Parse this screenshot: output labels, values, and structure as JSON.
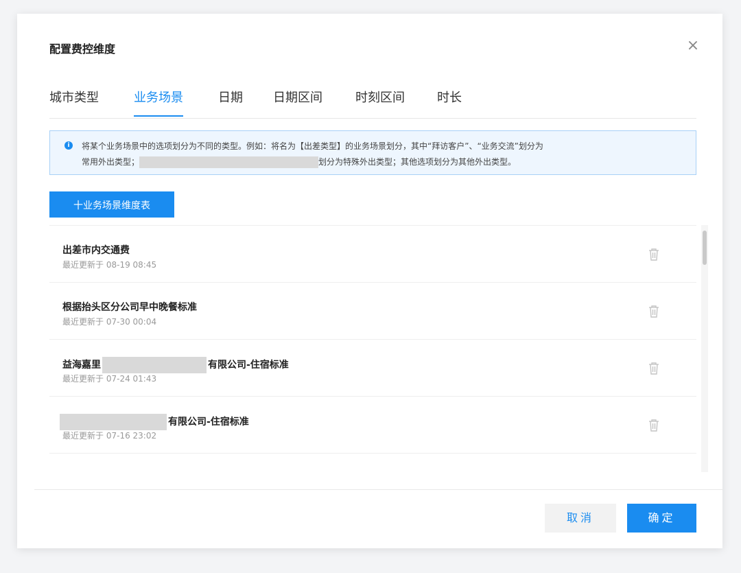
{
  "dialog": {
    "title": "配置费控维度",
    "close_glyph": "×"
  },
  "tabs": [
    {
      "label": "城市类型",
      "active": false
    },
    {
      "label": "业务场景",
      "active": true
    },
    {
      "label": "日期",
      "active": false
    },
    {
      "label": "日期区间",
      "active": false
    },
    {
      "label": "时刻区间",
      "active": false
    },
    {
      "label": "时长",
      "active": false
    }
  ],
  "notice": {
    "icon": "info-icon",
    "line1": "将某个业务场景中的选项划分为不同的类型。例如：将名为【出差类型】的业务场景划分，其中“拜访客户”、“业务交流”划分为",
    "line2_prefix": "常用外出类型；",
    "line2_suffix": "划分为特殊外出类型；其他选项划分为其他外出类型。"
  },
  "add_button": {
    "label": "十业务场景维度表"
  },
  "rows": [
    {
      "name": "出差市内交通费",
      "name_prefix": "",
      "name_suffix": "",
      "updated_label": "最近更新于",
      "updated_time": "08-19 08:45"
    },
    {
      "name": "根据抬头区分公司早中晚餐标准",
      "name_prefix": "",
      "name_suffix": "",
      "updated_label": "最近更新于",
      "updated_time": "07-30 00:04"
    },
    {
      "name": "",
      "name_prefix": "益海嘉里",
      "name_suffix": "有限公司-住宿标准",
      "updated_label": "最近更新于",
      "updated_time": "07-24 01:43"
    },
    {
      "name": "",
      "name_prefix": "",
      "name_suffix": "有限公司-住宿标准",
      "updated_label": "最近更新于",
      "updated_time": "07-16 23:02"
    }
  ],
  "footer": {
    "cancel_label": "取消",
    "ok_label": "确定"
  },
  "colors": {
    "accent": "#1a8cf0",
    "notice_bg": "#eef6fe",
    "notice_border": "#a7d0f7"
  }
}
